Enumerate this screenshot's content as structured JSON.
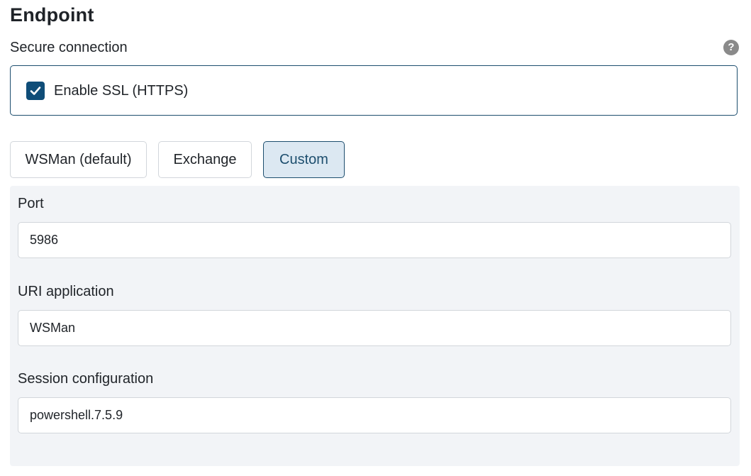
{
  "section": {
    "title": "Endpoint"
  },
  "secure_connection": {
    "label": "Secure connection",
    "help_icon": "question-circle-icon",
    "help_glyph": "?",
    "ssl_checkbox": {
      "label": "Enable SSL (HTTPS)",
      "checked": true,
      "icon": "checkmark-icon"
    }
  },
  "presets": {
    "selected": "Custom",
    "options": [
      {
        "label": "WSMan (default)"
      },
      {
        "label": "Exchange"
      },
      {
        "label": "Custom"
      }
    ]
  },
  "fields": {
    "port": {
      "label": "Port",
      "value": "5986"
    },
    "uri_application": {
      "label": "URI application",
      "value": "WSMan"
    },
    "session_configuration": {
      "label": "Session configuration",
      "value": "powershell.7.5.9"
    }
  },
  "colors": {
    "accent": "#0f4d78",
    "accent_border": "#1d4e6e",
    "active_bg": "#dce8f2",
    "panel_bg": "#f2f4f7",
    "border": "#d2d6db",
    "help_icon_bg": "#8a8a8a"
  }
}
